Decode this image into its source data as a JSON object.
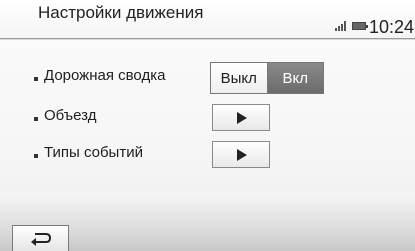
{
  "header": {
    "title": "Настройки движения",
    "time": "10:24",
    "signal_icon": "signal-bars-icon",
    "battery_icon": "battery-icon"
  },
  "settings": {
    "items": [
      {
        "label": "Дорожная сводка",
        "control": "toggle",
        "options": [
          "Выкл",
          "Вкл"
        ],
        "selected": "Вкл"
      },
      {
        "label": "Объезд",
        "control": "play-button",
        "icon": "play-icon"
      },
      {
        "label": "Типы событий",
        "control": "play-button",
        "icon": "play-icon"
      }
    ]
  },
  "footer": {
    "back_icon": "back-arrow-icon"
  },
  "colors": {
    "selected_toggle": "#777777",
    "header_line": "#9a9a9a"
  }
}
